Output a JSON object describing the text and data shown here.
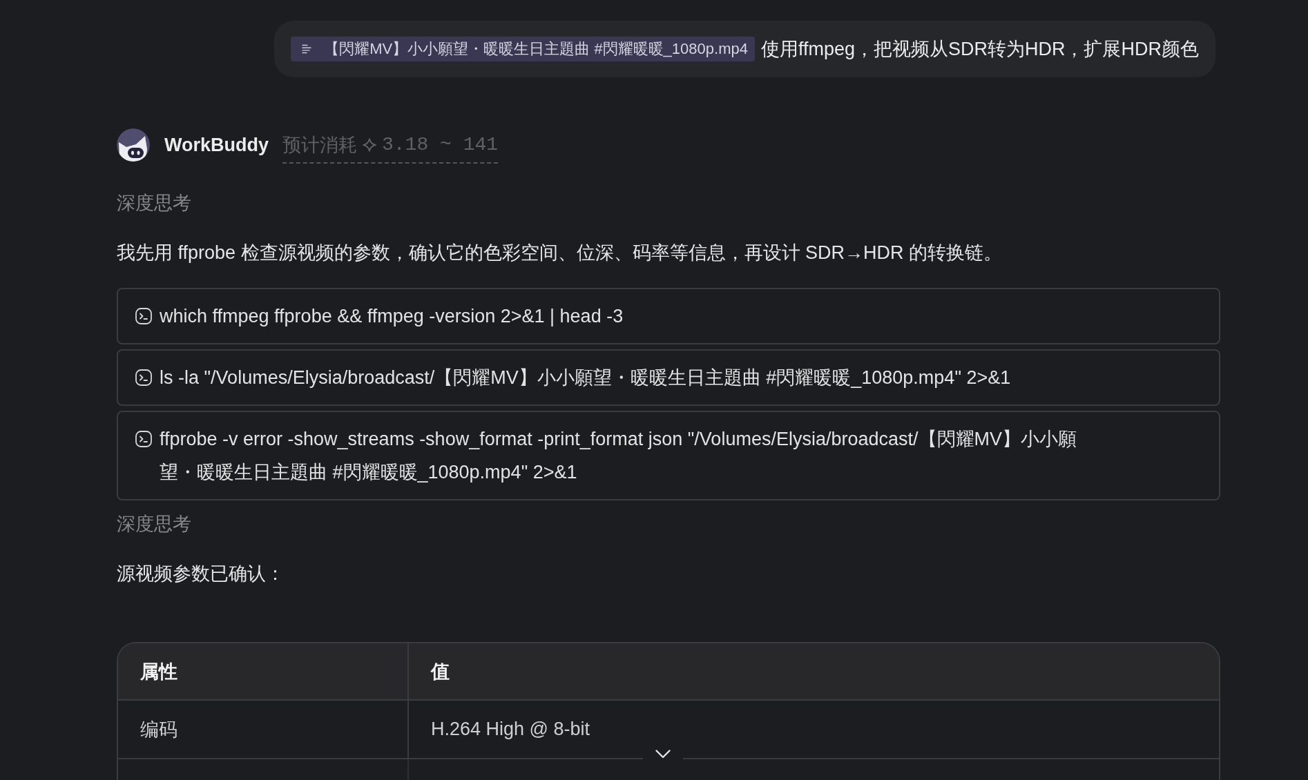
{
  "user_message": {
    "attachment": {
      "filename": "【閃耀MV】小小願望・暖暖生日主題曲 #閃耀暖暖_1080p.mp4"
    },
    "text": "使用ffmpeg，把视频从SDR转为HDR，扩展HDR颜色"
  },
  "assistant": {
    "name": "WorkBuddy",
    "cost_estimate": {
      "label": "预计消耗",
      "value": "3.18 ~ 141"
    }
  },
  "blocks": [
    {
      "kind": "thinking",
      "text": "深度思考"
    },
    {
      "kind": "paragraph",
      "text": "我先用 ffprobe 检查源视频的参数，确认它的色彩空间、位深、码率等信息，再设计 SDR→HDR 的转换链。"
    },
    {
      "kind": "command",
      "text": "which ffmpeg ffprobe && ffmpeg -version 2>&1 | head -3"
    },
    {
      "kind": "command",
      "text": "ls -la \"/Volumes/Elysia/broadcast/【閃耀MV】小小願望・暖暖生日主題曲 #閃耀暖暖_1080p.mp4\" 2>&1"
    },
    {
      "kind": "command",
      "text": "ffprobe -v error -show_streams -show_format -print_format json \"/Volumes/Elysia/broadcast/【閃耀MV】小小願望・暖暖生日主題曲 #閃耀暖暖_1080p.mp4\" 2>&1"
    },
    {
      "kind": "thinking",
      "text": "深度思考"
    },
    {
      "kind": "paragraph",
      "text": "源视频参数已确认："
    },
    {
      "kind": "table",
      "columns": [
        "属性",
        "值"
      ],
      "rows": [
        [
          "编码",
          "H.264 High @ 8-bit"
        ]
      ]
    }
  ]
}
